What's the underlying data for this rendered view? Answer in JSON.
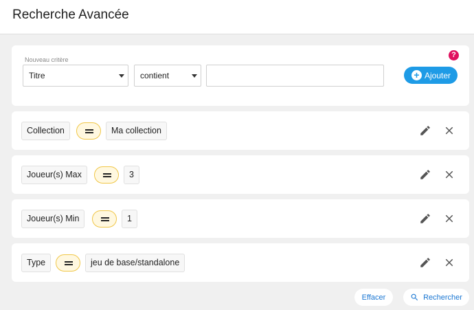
{
  "header": {
    "title": "Recherche Avancée"
  },
  "new_criterion": {
    "caption": "Nouveau critère",
    "field_value": "Titre",
    "operator_value": "contient",
    "value_input": "",
    "add_label": "Ajouter",
    "help_glyph": "?"
  },
  "filters": [
    {
      "field": "Collection",
      "operator": "=",
      "value": "Ma collection"
    },
    {
      "field": "Joueur(s) Max",
      "operator": "=",
      "value": "3"
    },
    {
      "field": "Joueur(s) Min",
      "operator": "=",
      "value": "1"
    },
    {
      "field": "Type",
      "operator": "=",
      "value": "jeu de base/standalone"
    }
  ],
  "actions": {
    "clear_label": "Effacer",
    "search_label": "Rechercher"
  },
  "icons": {
    "help": "help-circle-icon",
    "add": "plus-circle-icon",
    "edit": "pencil-icon",
    "delete": "close-icon",
    "search": "search-icon"
  },
  "colors": {
    "primary": "#1e9be6",
    "help": "#e0115f",
    "operator_border": "#f0c646",
    "link": "#1976d2"
  }
}
